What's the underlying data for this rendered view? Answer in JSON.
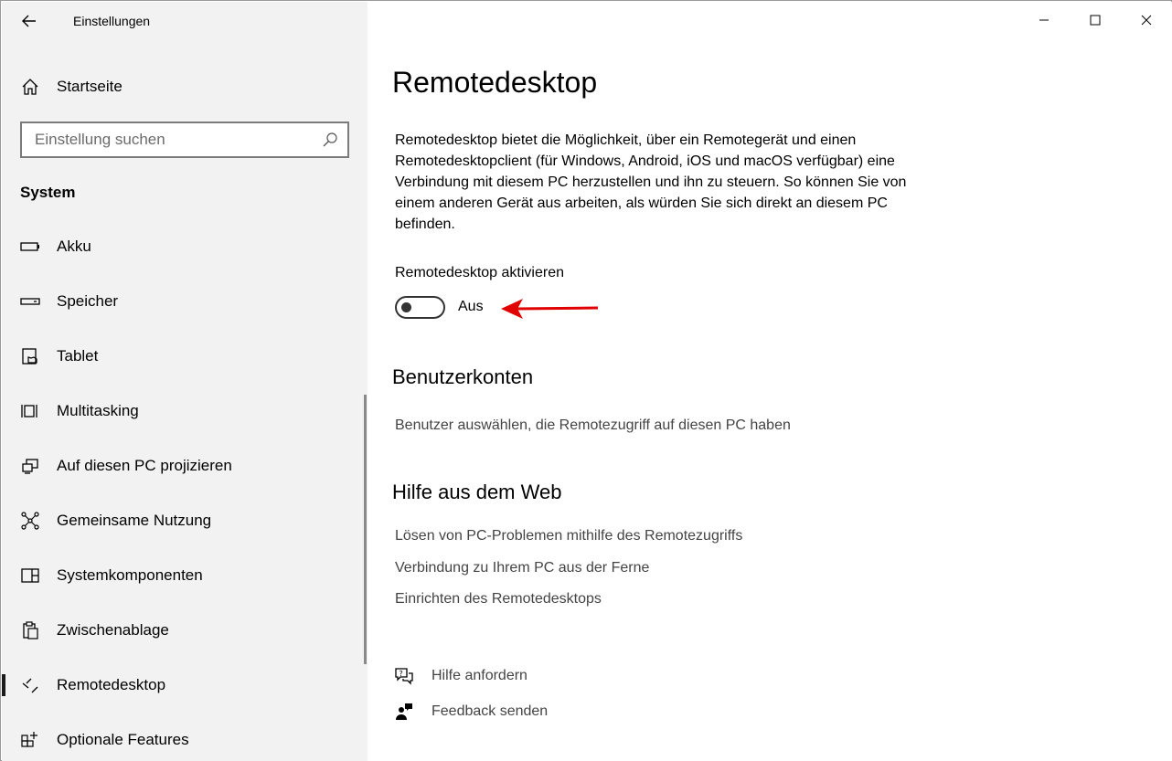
{
  "window": {
    "title": "Einstellungen"
  },
  "sidebar": {
    "home_label": "Startseite",
    "search_placeholder": "Einstellung suchen",
    "section_title": "System",
    "items": [
      {
        "label": "Akku",
        "icon": "battery-icon"
      },
      {
        "label": "Speicher",
        "icon": "storage-icon"
      },
      {
        "label": "Tablet",
        "icon": "tablet-icon"
      },
      {
        "label": "Multitasking",
        "icon": "multitasking-icon"
      },
      {
        "label": "Auf diesen PC projizieren",
        "icon": "project-icon"
      },
      {
        "label": "Gemeinsame Nutzung",
        "icon": "share-icon"
      },
      {
        "label": "Systemkomponenten",
        "icon": "components-icon"
      },
      {
        "label": "Zwischenablage",
        "icon": "clipboard-icon"
      },
      {
        "label": "Remotedesktop",
        "icon": "remote-desktop-icon",
        "selected": true
      },
      {
        "label": "Optionale Features",
        "icon": "optional-features-icon"
      }
    ]
  },
  "main": {
    "title": "Remotedesktop",
    "description": "Remotedesktop bietet die Möglichkeit, über ein Remotegerät und einen Remotedesktopclient (für Windows, Android, iOS und macOS verfügbar) eine Verbindung mit diesem PC herzustellen und ihn zu steuern. So können Sie von einem anderen Gerät aus arbeiten, als würden Sie sich direkt an diesem PC befinden.",
    "toggle": {
      "label": "Remotedesktop aktivieren",
      "state_text": "Aus",
      "on": false
    },
    "accounts": {
      "heading": "Benutzerkonten",
      "link": "Benutzer auswählen, die Remotezugriff auf diesen PC haben"
    },
    "web_help": {
      "heading": "Hilfe aus dem Web",
      "links": [
        "Lösen von PC-Problemen mithilfe des Remotezugriffs",
        "Verbindung zu Ihrem PC aus der Ferne",
        "Einrichten des Remotedesktops"
      ]
    },
    "get_help": "Hilfe anfordern",
    "feedback": "Feedback senden"
  },
  "colors": {
    "sidebar_bg": "#f2f2f2",
    "annotation_arrow": "#e00000",
    "link_text": "#444444"
  }
}
